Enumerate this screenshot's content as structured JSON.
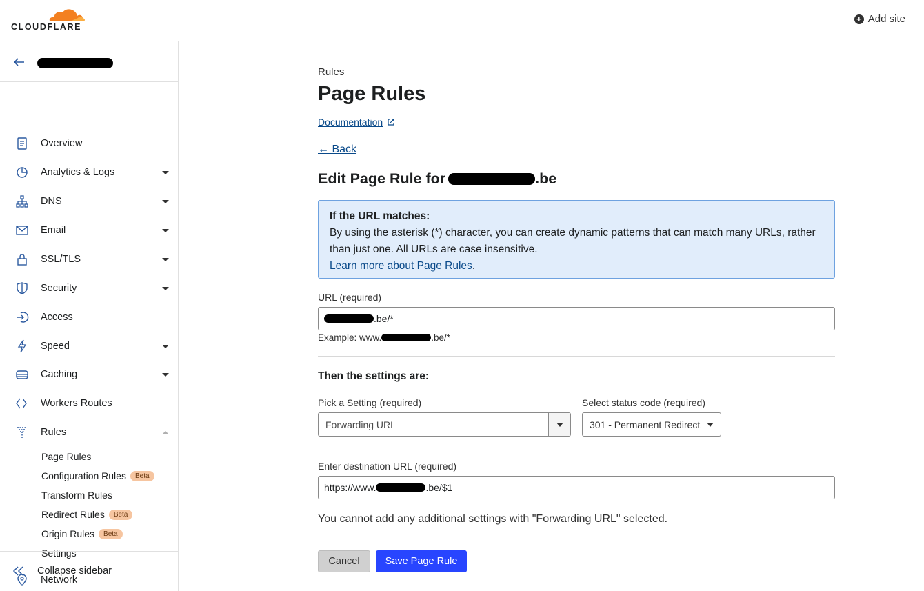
{
  "header": {
    "logo_text": "CLOUDFLARE",
    "add_site_label": "Add site"
  },
  "sidebar": {
    "items": [
      {
        "label": "Overview",
        "icon": "document-icon"
      },
      {
        "label": "Analytics & Logs",
        "icon": "pie-chart-icon"
      },
      {
        "label": "DNS",
        "icon": "network-tree-icon"
      },
      {
        "label": "Email",
        "icon": "envelope-icon"
      },
      {
        "label": "SSL/TLS",
        "icon": "lock-icon"
      },
      {
        "label": "Security",
        "icon": "shield-icon"
      },
      {
        "label": "Access",
        "icon": "sign-in-icon"
      },
      {
        "label": "Speed",
        "icon": "lightning-icon"
      },
      {
        "label": "Caching",
        "icon": "storage-icon"
      },
      {
        "label": "Workers Routes",
        "icon": "workers-icon"
      },
      {
        "label": "Rules",
        "icon": "filter-icon"
      },
      {
        "label": "Network",
        "icon": "location-pin-icon"
      }
    ],
    "rules_sub": [
      {
        "label": "Page Rules"
      },
      {
        "label": "Configuration Rules",
        "badge": "Beta"
      },
      {
        "label": "Transform Rules"
      },
      {
        "label": "Redirect Rules",
        "badge": "Beta"
      },
      {
        "label": "Origin Rules",
        "badge": "Beta"
      },
      {
        "label": "Settings"
      }
    ],
    "collapse_label": "Collapse sidebar"
  },
  "main": {
    "breadcrumb": "Rules",
    "title": "Page Rules",
    "doc_link": "Documentation",
    "back_link": "Back",
    "edit_title_prefix": "Edit Page Rule for",
    "edit_title_suffix": ".be",
    "info": {
      "heading": "If the URL matches:",
      "body": "By using the asterisk (*) character, you can create dynamic patterns that can match many URLs, rather than just one. All URLs are case insensitive.",
      "link": "Learn more about Page Rules",
      "link_suffix": "."
    },
    "url_label": "URL (required)",
    "url_value_suffix": ".be/*",
    "example_prefix": "Example: www.",
    "example_suffix": ".be/*",
    "settings_title": "Then the settings are:",
    "pick_label": "Pick a Setting (required)",
    "pick_value": "Forwarding URL",
    "status_label": "Select status code (required)",
    "status_value": "301 - Permanent Redirect",
    "dest_label": "Enter destination URL (required)",
    "dest_prefix": "https://www.",
    "dest_suffix": ".be/$1",
    "note": "You cannot add any additional settings with \"Forwarding URL\" selected.",
    "cancel_label": "Cancel",
    "save_label": "Save Page Rule"
  },
  "colors": {
    "accent_blue": "#2845ff",
    "logo_orange": "#f38020",
    "info_bg": "#e1edfb"
  }
}
